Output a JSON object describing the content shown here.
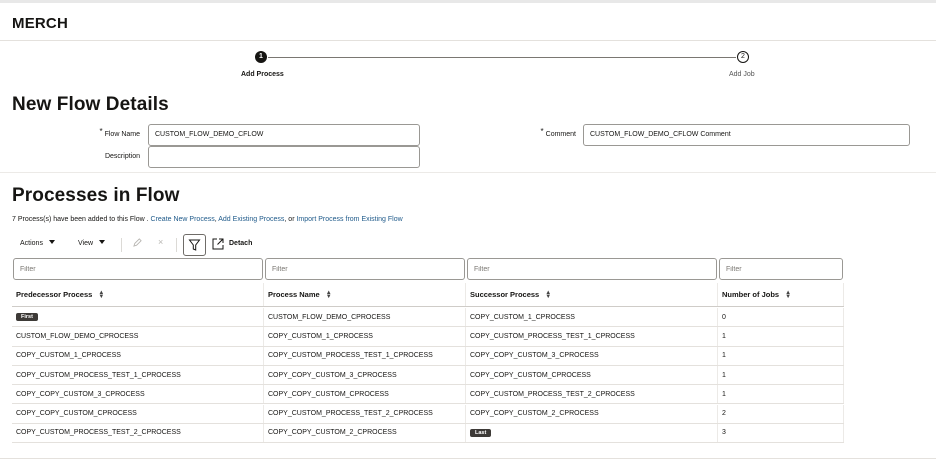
{
  "app": {
    "title": "MERCH"
  },
  "train": {
    "steps": [
      {
        "number": "1",
        "label": "Add Process"
      },
      {
        "number": "2",
        "label": "Add Job"
      }
    ]
  },
  "flow_details": {
    "heading": "New Flow Details",
    "flow_name_label": "Flow Name",
    "flow_name_value": "CUSTOM_FLOW_DEMO_CFLOW",
    "comment_label": "Comment",
    "comment_value": "CUSTOM_FLOW_DEMO_CFLOW Comment",
    "description_label": "Description",
    "description_value": "",
    "required_mark": "*"
  },
  "processes": {
    "heading": "Processes in Flow",
    "info_prefix": "7 Process(s) have been added to this Flow .",
    "link_create": "Create New Process",
    "link_add": "Add Existing Process",
    "info_or": ", or",
    "link_import": "Import Process from Existing Flow"
  },
  "toolbar": {
    "actions_label": "Actions",
    "view_label": "View",
    "detach_label": "Detach"
  },
  "table": {
    "filter_placeholder": "Filter",
    "columns": [
      "Predecessor Process",
      "Process Name",
      "Successor Process",
      "Number of Jobs"
    ],
    "rows": [
      {
        "pred": "",
        "pred_badge": "First",
        "name": "CUSTOM_FLOW_DEMO_CPROCESS",
        "succ": "COPY_CUSTOM_1_CPROCESS",
        "succ_badge": "",
        "jobs": "0"
      },
      {
        "pred": "CUSTOM_FLOW_DEMO_CPROCESS",
        "pred_badge": "",
        "name": "COPY_CUSTOM_1_CPROCESS",
        "succ": "COPY_CUSTOM_PROCESS_TEST_1_CPROCESS",
        "succ_badge": "",
        "jobs": "1"
      },
      {
        "pred": "COPY_CUSTOM_1_CPROCESS",
        "pred_badge": "",
        "name": "COPY_CUSTOM_PROCESS_TEST_1_CPROCESS",
        "succ": "COPY_COPY_CUSTOM_3_CPROCESS",
        "succ_badge": "",
        "jobs": "1"
      },
      {
        "pred": "COPY_CUSTOM_PROCESS_TEST_1_CPROCESS",
        "pred_badge": "",
        "name": "COPY_COPY_CUSTOM_3_CPROCESS",
        "succ": "COPY_COPY_CUSTOM_CPROCESS",
        "succ_badge": "",
        "jobs": "1"
      },
      {
        "pred": "COPY_COPY_CUSTOM_3_CPROCESS",
        "pred_badge": "",
        "name": "COPY_COPY_CUSTOM_CPROCESS",
        "succ": "COPY_CUSTOM_PROCESS_TEST_2_CPROCESS",
        "succ_badge": "",
        "jobs": "1"
      },
      {
        "pred": "COPY_COPY_CUSTOM_CPROCESS",
        "pred_badge": "",
        "name": "COPY_CUSTOM_PROCESS_TEST_2_CPROCESS",
        "succ": "COPY_COPY_CUSTOM_2_CPROCESS",
        "succ_badge": "",
        "jobs": "2"
      },
      {
        "pred": "COPY_CUSTOM_PROCESS_TEST_2_CPROCESS",
        "pred_badge": "",
        "name": "COPY_COPY_CUSTOM_2_CPROCESS",
        "succ": "",
        "succ_badge": "Last",
        "jobs": "3"
      }
    ]
  },
  "icons": {
    "sort": "sort-icon",
    "edit": "pencil-icon",
    "delete": "close-icon",
    "filter": "funnel-icon",
    "detach": "detach-icon"
  }
}
